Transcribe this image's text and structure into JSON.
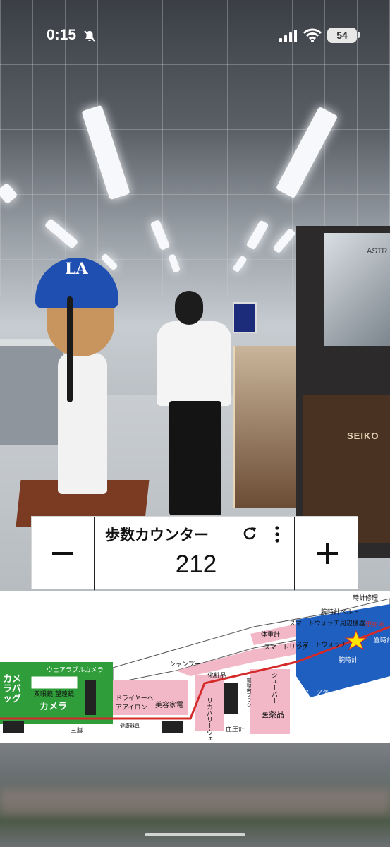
{
  "status_bar": {
    "time": "0:15",
    "battery": "54",
    "icons": [
      "bell-slash-icon",
      "signal-icon",
      "wifi-icon",
      "battery-icon"
    ]
  },
  "scene": {
    "seiko_sign": "SEIKO",
    "astr_sign": "ASTR"
  },
  "step_counter": {
    "title": "歩数カウンター",
    "value": "212",
    "minus_icon": "minus-icon",
    "plus_icon": "plus-icon",
    "refresh_icon": "refresh-icon",
    "more_icon": "more-vertical-icon"
  },
  "floor_map": {
    "labels": {
      "clock_repair": "時計修理",
      "watch_belt": "腕時計ベルト",
      "smartwatch_acc": "スマートウォッチ周辺機器",
      "scale": "体重計",
      "smart_ring": "スマートリング",
      "smart_watch": "スマートウォッチ",
      "wrist_watch": "腕時計",
      "shampoo": "シャンプー",
      "cosmetics": "化粧品",
      "wearable_camera": "ウェアラブルカメラ",
      "camera_bag": "カメラバッグ",
      "binoculars": "双眼鏡",
      "telescope": "望遠鏡",
      "camera": "カメラ",
      "dryer": "ドライヤーヘアアイロン",
      "beauty": "美容家電",
      "recovery_wear": "リカバリーウェア",
      "bp_meter": "血圧計",
      "medicine": "医薬品",
      "shaver": "シェーバー",
      "suitcase": "スーツケース",
      "electric_toothbrush": "電動歯ブラシ",
      "tripod": "三脚",
      "health": "健康器具",
      "wall_clock": "置時計掛時計",
      "current_pos": "現在地"
    }
  }
}
